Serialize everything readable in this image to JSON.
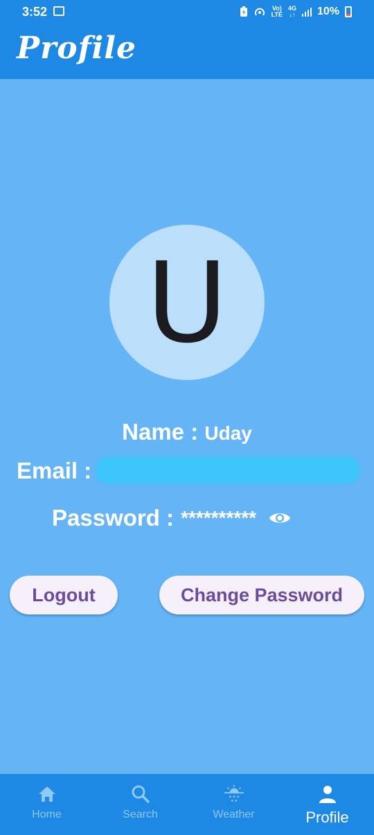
{
  "status_bar": {
    "time": "3:52",
    "network_top": "Vo)",
    "network_bottom": "LTE",
    "signal_top": "4G",
    "signal_bottom": "↓↑",
    "battery": "10%"
  },
  "appbar": {
    "title": "Profile"
  },
  "avatar": {
    "initial": "U"
  },
  "profile": {
    "name_label": "Name : ",
    "name_value": "Uday",
    "email_label": "Email : ",
    "password_label": "Password : ",
    "password_value": "**********"
  },
  "buttons": {
    "logout": "Logout",
    "change_password": "Change Password"
  },
  "nav": {
    "items": [
      {
        "label": "Home",
        "icon": "home-icon"
      },
      {
        "label": "Search",
        "icon": "search-icon"
      },
      {
        "label": "Weather",
        "icon": "weather-icon"
      },
      {
        "label": "Profile",
        "icon": "person-icon"
      }
    ],
    "active": "Profile"
  },
  "colors": {
    "primary": "#1e88e5",
    "background": "#64b4f6",
    "avatar_bg": "#bbdefb",
    "button_bg": "#f6f0fa",
    "button_text": "#6a4c9c"
  }
}
